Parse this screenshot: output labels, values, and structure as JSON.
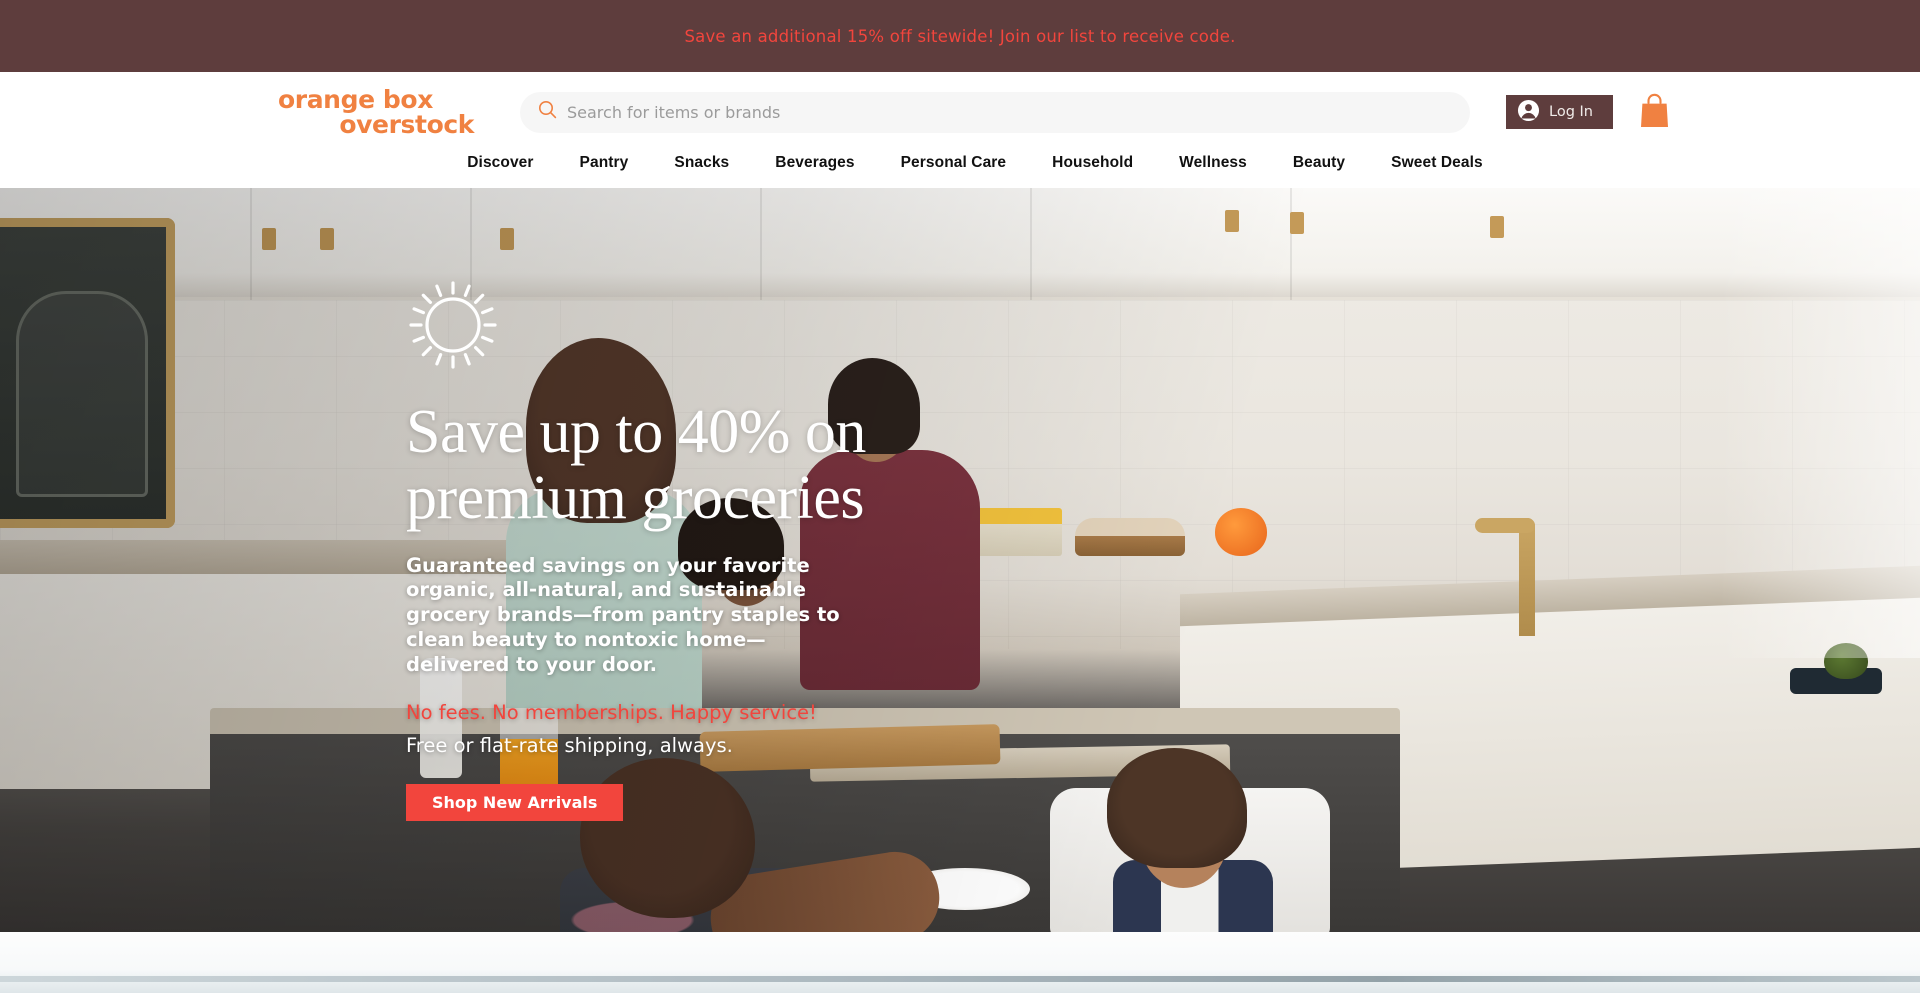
{
  "announcement": {
    "text": "Save an additional 15% off sitewide! Join our list to receive code.",
    "bg_color": "#5e3d3d",
    "text_color": "#f2453d"
  },
  "header": {
    "logo": {
      "line1": "orange box",
      "line2": "overstock",
      "color": "#f08141"
    },
    "search": {
      "placeholder": "Search for items or brands",
      "icon": "search-icon",
      "value": ""
    },
    "login": {
      "label": "Log In",
      "icon": "avatar-icon",
      "bg_color": "#5e3d3d"
    },
    "cart": {
      "icon": "shopping-bag-icon",
      "color": "#f08141"
    }
  },
  "nav": {
    "items": [
      {
        "label": "Discover"
      },
      {
        "label": "Pantry"
      },
      {
        "label": "Snacks"
      },
      {
        "label": "Beverages"
      },
      {
        "label": "Personal Care"
      },
      {
        "label": "Household"
      },
      {
        "label": "Wellness"
      },
      {
        "label": "Beauty"
      },
      {
        "label": "Sweet Deals"
      }
    ]
  },
  "hero": {
    "decor_icon": "sun-icon",
    "title": "Save up to 40% on premium groceries",
    "body": "Guaranteed savings on your favorite organic, all-natural, and sustainable grocery brands—from pantry staples to clean beauty to nontoxic home—delivered to your door.",
    "highlight": "No fees. No memberships. Happy service!",
    "subtext": "Free or flat-rate shipping, always.",
    "cta_label": "Shop New Arrivals",
    "cta_color": "#f2453d",
    "image_alt": "Family with children eating breakfast in a bright white kitchen"
  }
}
